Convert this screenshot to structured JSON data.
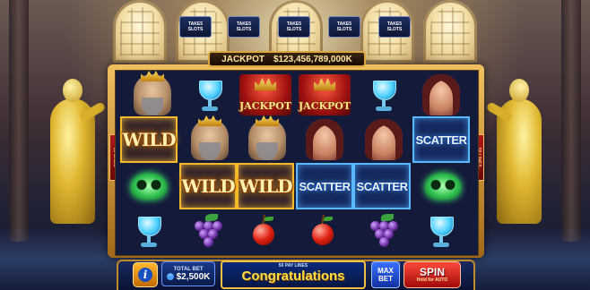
{
  "top_tabs": [
    {
      "label": "TAKE5 SLOTS"
    },
    {
      "label": "TAKE5 SLOTS"
    },
    {
      "label": "TAKE5 SLOTS"
    },
    {
      "label": "TAKE5 SLOTS"
    },
    {
      "label": "TAKE5 SLOTS"
    }
  ],
  "jackpot": {
    "label": "JACKPOT",
    "amount": "$123,456,789,000K"
  },
  "side_labels": {
    "left": "50 LINES",
    "right": "50 LINES"
  },
  "reels": [
    [
      "king",
      "goblet",
      "jackpot",
      "jackpot",
      "goblet",
      "queen"
    ],
    [
      "wild",
      "king",
      "king",
      "queen",
      "queen",
      "scatter"
    ],
    [
      "mask",
      "wild",
      "wild",
      "scatter",
      "scatter",
      "mask"
    ],
    [
      "goblet",
      "grapes",
      "cherry",
      "cherry",
      "grapes",
      "goblet"
    ]
  ],
  "symbol_text": {
    "wild": "WILD",
    "scatter": "SCATTER",
    "jackpot": "JACKPOT"
  },
  "bottom_bar": {
    "info_icon": "i",
    "total_bet_label": "TOTAL BET",
    "total_bet_value": "$2,500K",
    "minus": "−",
    "paylines_label": "50 PAY LINES",
    "message": "Congratulations",
    "max_bet_line1": "MAX",
    "max_bet_line2": "BET",
    "spin_label": "SPIN",
    "spin_hint": "Hold for AUTO"
  },
  "colors": {
    "gold": "#f5b82a",
    "blue_highlight": "#5ab8ff",
    "message_yellow": "#ffe040",
    "spin_red": "#d01818"
  }
}
